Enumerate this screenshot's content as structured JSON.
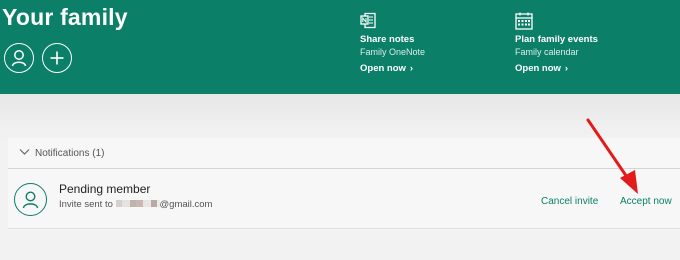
{
  "colors": {
    "brand": "#0b7f68",
    "annotation_arrow": "#e31b1b"
  },
  "header": {
    "title": "Your family",
    "buttons": [
      {
        "icon": "person-icon"
      },
      {
        "icon": "plus-icon"
      }
    ],
    "features": [
      {
        "icon": "onenote-icon",
        "title": "Share notes",
        "subtitle": "Family OneNote",
        "link": "Open now"
      },
      {
        "icon": "calendar-icon",
        "title": "Plan family events",
        "subtitle": "Family calendar",
        "link": "Open now"
      }
    ]
  },
  "notifications": {
    "label": "Notifications (1)",
    "items": [
      {
        "name": "Pending member",
        "subtitle_prefix": "Invite sent to",
        "subtitle_suffix": "@gmail.com",
        "actions": [
          "Cancel invite",
          "Accept now"
        ]
      }
    ]
  }
}
